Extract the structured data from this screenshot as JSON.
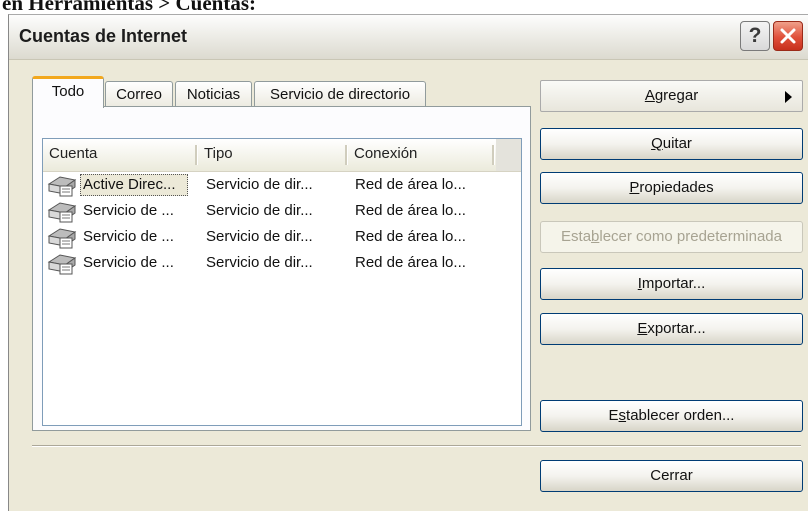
{
  "page_heading_fragment": "en Herramientas > Cuentas:",
  "window": {
    "title": "Cuentas de Internet",
    "help_glyph": "?"
  },
  "tabs": [
    {
      "label": "Todo",
      "active": true
    },
    {
      "label": "Correo"
    },
    {
      "label": "Noticias"
    },
    {
      "label": "Servicio de directorio"
    }
  ],
  "list": {
    "columns": [
      "Cuenta",
      "Tipo",
      "Conexión"
    ],
    "rows": [
      {
        "account": "Active Direc...",
        "type": "Servicio de dir...",
        "connection": "Red de área lo...",
        "selected": true
      },
      {
        "account": "Servicio de ...",
        "type": "Servicio de dir...",
        "connection": "Red de área lo..."
      },
      {
        "account": "Servicio de ...",
        "type": "Servicio de dir...",
        "connection": "Red de área lo..."
      },
      {
        "account": "Servicio de ...",
        "type": "Servicio de dir...",
        "connection": "Red de área lo..."
      }
    ],
    "row_icon": "directory-service-icon"
  },
  "buttons": {
    "add": {
      "pre": "",
      "key": "A",
      "post": "gregar"
    },
    "remove": {
      "pre": "",
      "key": "Q",
      "post": "uitar"
    },
    "properties": {
      "pre": "",
      "key": "P",
      "post": "ropiedades"
    },
    "set_default": {
      "pre": "Esta",
      "key": "b",
      "post": "lecer como predeterminada"
    },
    "import": {
      "pre": "",
      "key": "I",
      "post": "mportar..."
    },
    "export": {
      "pre": "",
      "key": "E",
      "post": "xportar..."
    },
    "set_order": {
      "pre": "E",
      "key": "s",
      "post": "tablecer orden..."
    },
    "close": {
      "pre": "",
      "key": "",
      "post": "Cerrar"
    }
  },
  "colors": {
    "close_button": "#e0503a",
    "active_tab_accent": "#f2a81e",
    "button_border": "#003c74"
  }
}
